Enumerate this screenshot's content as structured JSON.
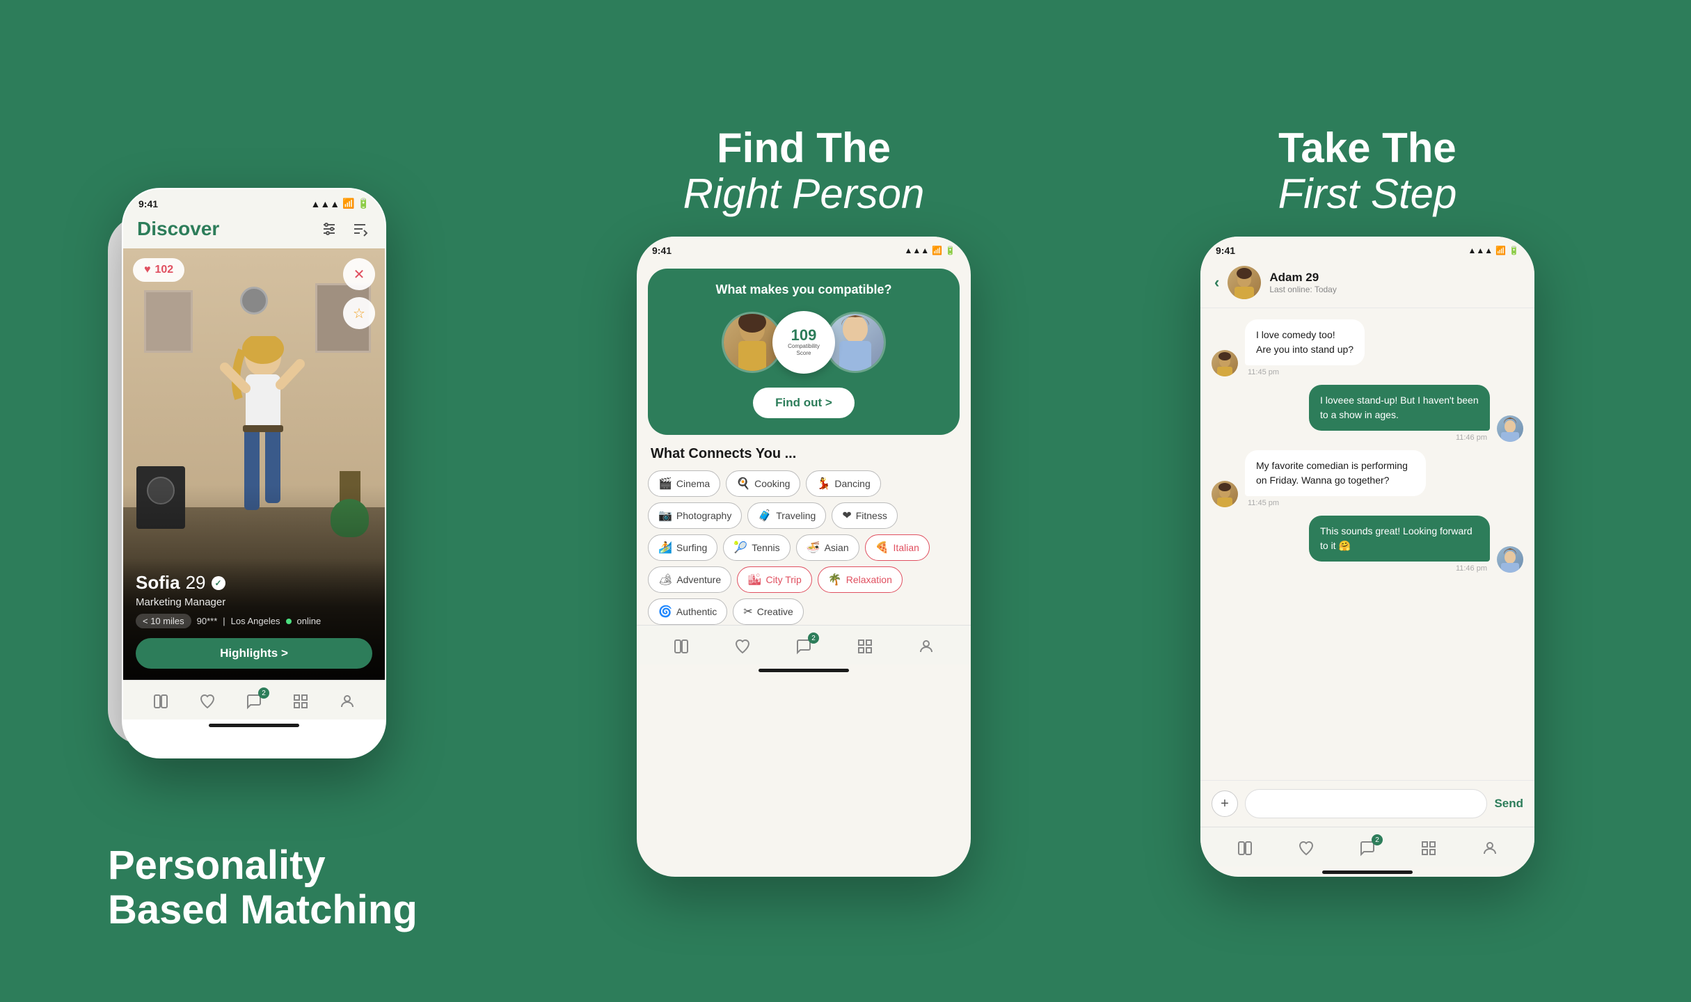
{
  "section1": {
    "headline_line1": "Personality",
    "headline_line2": "Based Matching",
    "status_time": "9:41",
    "app_title": "Discover",
    "filter_icon": "⚙",
    "sort_icon": "↓",
    "likes_count": "102",
    "profile_name": "Sofia",
    "profile_age": "29",
    "profile_job": "Marketing Manager",
    "profile_distance": "< 10 miles",
    "profile_score": "90***",
    "profile_city": "Los Angeles",
    "profile_status": "online",
    "highlights_btn": "Highlights >",
    "nav_messages_badge": "2"
  },
  "section2": {
    "headline_line1": "Find The",
    "headline_line2": "Right Person",
    "status_time": "9:41",
    "compat_title": "What makes you compatible?",
    "compat_score": "109",
    "compat_score_label": "Compatibility Score",
    "find_out_btn": "Find out >",
    "connects_title": "What Connects You ...",
    "tags": [
      {
        "label": "Cinema",
        "icon": "🎬",
        "type": "normal"
      },
      {
        "label": "Cooking",
        "icon": "🍳",
        "type": "normal"
      },
      {
        "label": "Dancing",
        "icon": "💃",
        "type": "normal"
      },
      {
        "label": "Photography",
        "icon": "📷",
        "type": "normal"
      },
      {
        "label": "Traveling",
        "icon": "🧳",
        "type": "normal"
      },
      {
        "label": "Fitness",
        "icon": "❤",
        "type": "normal"
      },
      {
        "label": "Surfing",
        "icon": "🏄",
        "type": "normal"
      },
      {
        "label": "Tennis",
        "icon": "🎾",
        "type": "normal"
      },
      {
        "label": "Asian",
        "icon": "🍜",
        "type": "normal"
      },
      {
        "label": "Italian",
        "icon": "🍕",
        "type": "normal"
      },
      {
        "label": "Adventure",
        "icon": "🏕",
        "type": "normal"
      },
      {
        "label": "City Trip",
        "icon": "🏙",
        "type": "pink"
      },
      {
        "label": "Relaxation",
        "icon": "🌴",
        "type": "pink"
      },
      {
        "label": "Authentic",
        "icon": "🌀",
        "type": "normal"
      },
      {
        "label": "Creative",
        "icon": "✂",
        "type": "normal"
      }
    ],
    "nav_messages_badge": "2"
  },
  "section3": {
    "headline_line1": "Take The",
    "headline_line2": "First Step",
    "status_time": "9:41",
    "chat_user_name": "Adam 29",
    "chat_user_status": "Last online: Today",
    "messages": [
      {
        "direction": "incoming",
        "text": "I love comedy too! Are you into stand up?",
        "time": "11:45 pm"
      },
      {
        "direction": "outgoing",
        "text": "I loveee stand-up! But I haven't been to a show in ages.",
        "time": "11:46 pm"
      },
      {
        "direction": "incoming",
        "text": "My favorite comedian is performing on Friday. Wanna go together?",
        "time": "11:45 pm"
      },
      {
        "direction": "outgoing",
        "text": "This sounds great! Looking forward to it 🤗",
        "time": "11:46 pm"
      }
    ],
    "input_placeholder": "",
    "send_btn": "Send",
    "nav_messages_badge": "2"
  }
}
